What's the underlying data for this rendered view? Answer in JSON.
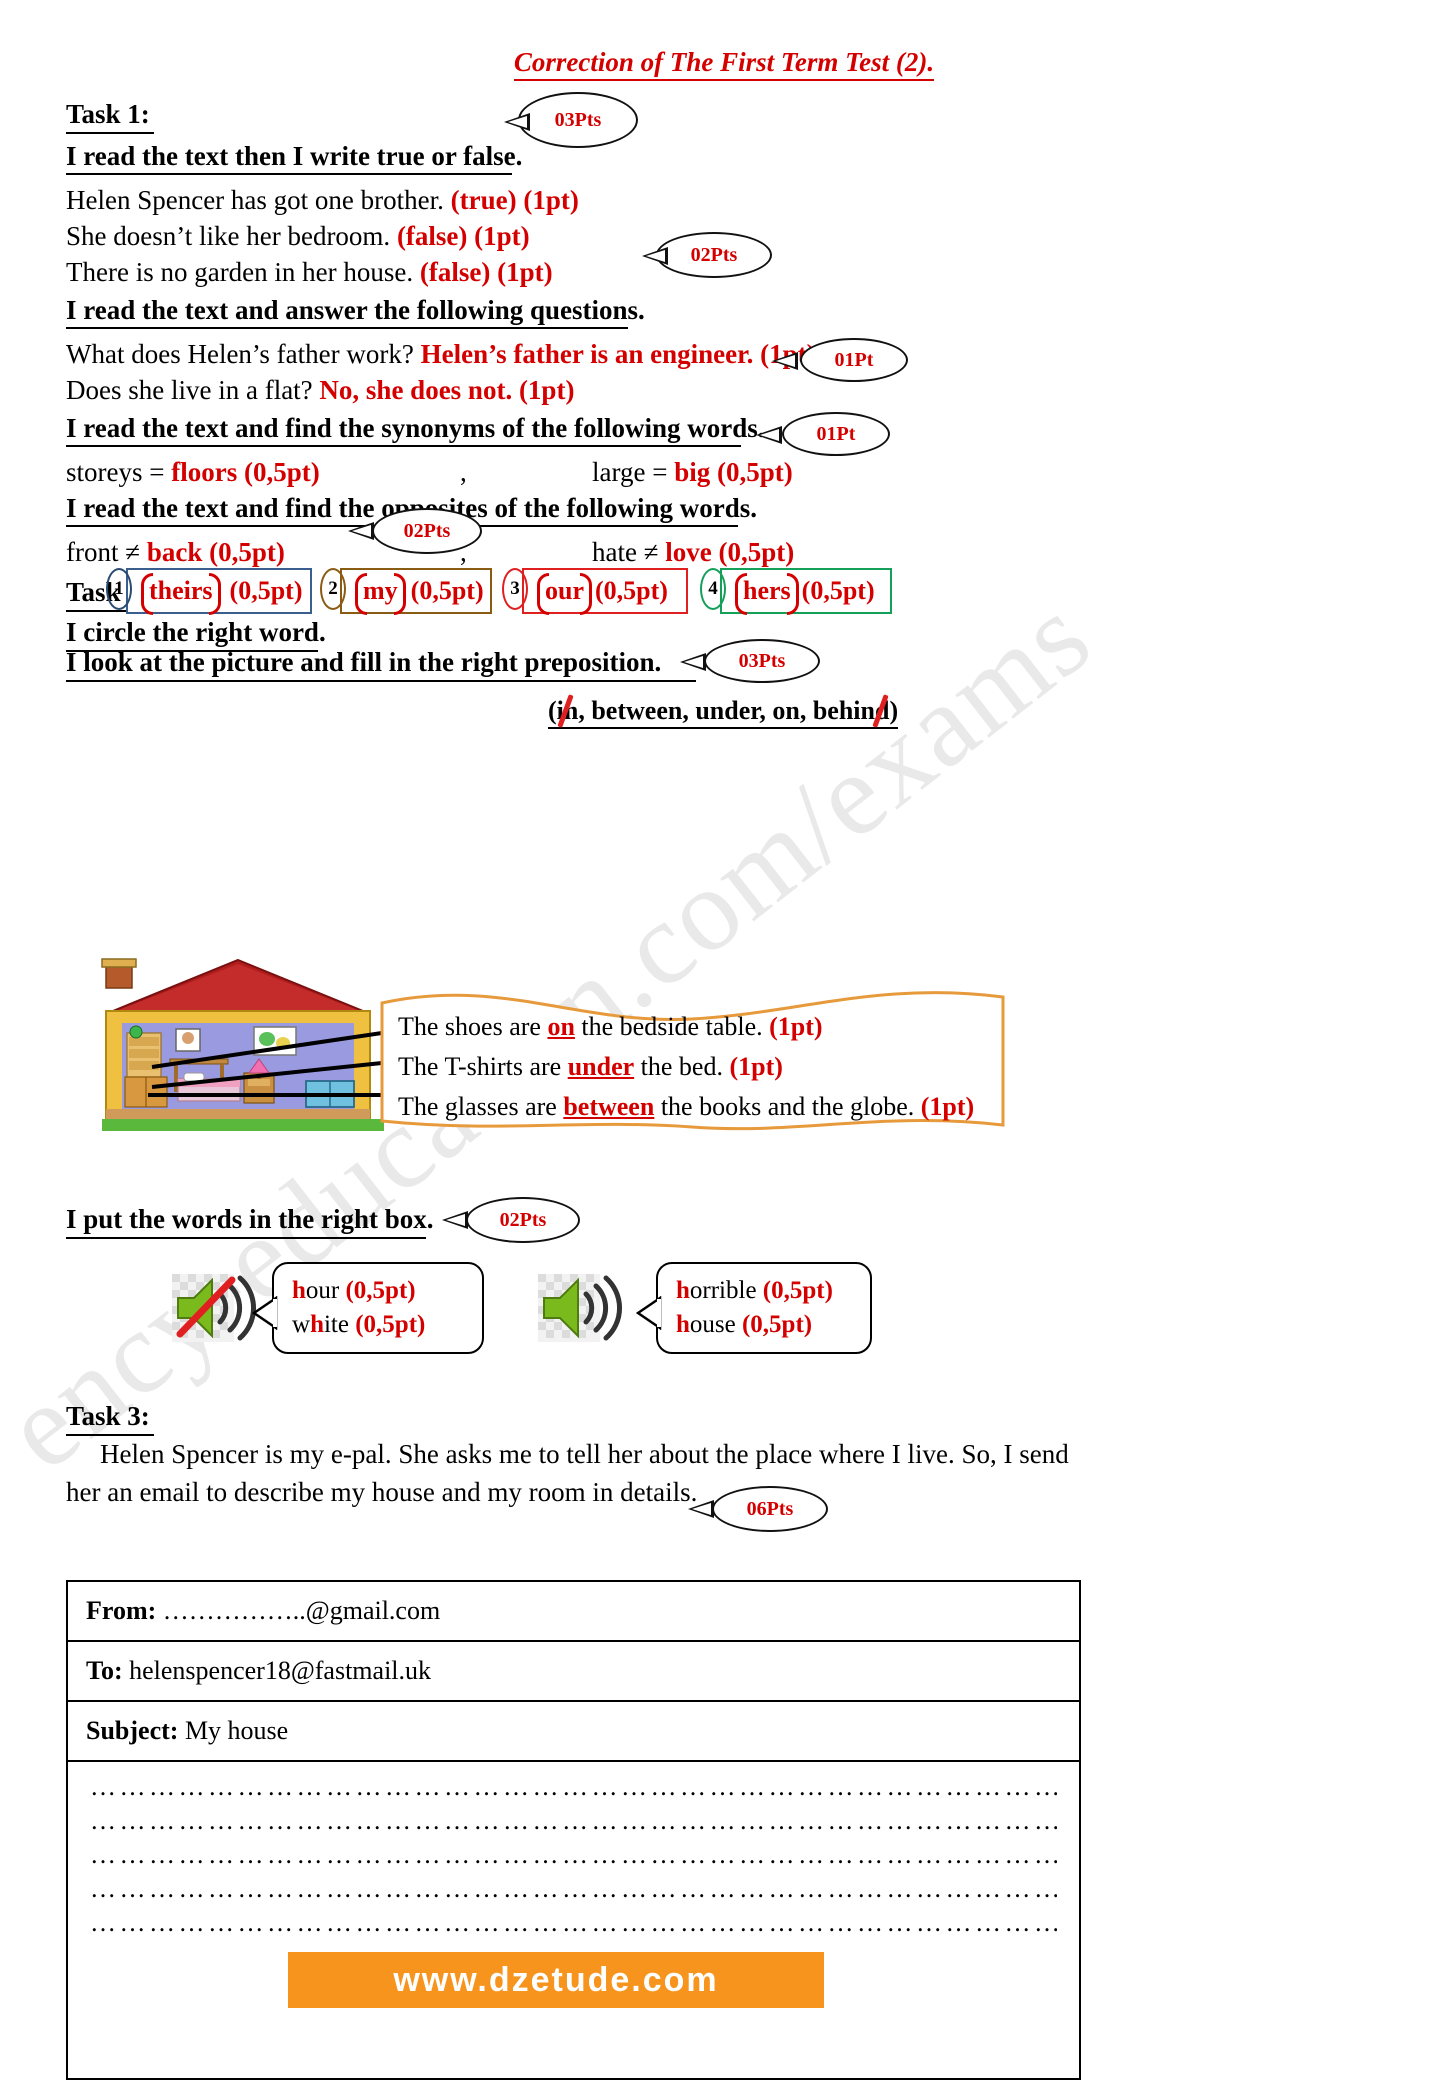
{
  "document": {
    "title": "Correction of The First Term Test (2).",
    "watermark": "ency-education.com/exams",
    "footer_url": "www.dzetude.com"
  },
  "task1": {
    "label": "Task 1:",
    "sections": [
      {
        "instruction": "I read the text then I write true or false.",
        "points": "03Pts",
        "items": [
          {
            "question": "Helen Spencer has got one brother.",
            "answer": "(true) (1pt)"
          },
          {
            "question": "She doesn’t like her bedroom.",
            "answer": "(false) (1pt)"
          },
          {
            "question": "There is no garden in her house.",
            "answer": "(false) (1pt)"
          }
        ]
      },
      {
        "instruction": "I read the text and answer the following questions.",
        "points": "02Pts",
        "items": [
          {
            "question": "What does Helen’s father work?",
            "answer": "Helen’s father is an engineer. (1pt)"
          },
          {
            "question": "Does she live in a flat?",
            "answer": "No, she does not. (1pt)"
          }
        ]
      },
      {
        "instruction": "I read the text and find the synonyms of the following words.",
        "points": "01Pt",
        "pairs": [
          {
            "left": "storeys =",
            "answer": "floors (0,5pt)"
          },
          {
            "separator": ","
          },
          {
            "left": "large =",
            "answer": "big (0,5pt)"
          }
        ]
      },
      {
        "instruction": "I read the text and find the opposites of the following words.",
        "points": "01Pt",
        "pairs": [
          {
            "left": "front ≠",
            "answer": "back (0,5pt)"
          },
          {
            "separator": ","
          },
          {
            "left": "hate ≠",
            "answer": "love (0,5pt)"
          }
        ]
      }
    ]
  },
  "task2": {
    "label": "Task 2:",
    "circle_activity": {
      "instruction": "I circle the right word.",
      "points": "02Pts",
      "options": [
        {
          "number": "1",
          "word": "theirs",
          "mark": "(0,5pt)",
          "box_color": "#3a5f8f"
        },
        {
          "number": "2",
          "word": "my",
          "mark": "(0,5pt)",
          "box_color": "#8a5b12"
        },
        {
          "number": "3",
          "word": "our",
          "mark": "(0,5pt)",
          "box_color": "#e02020"
        },
        {
          "number": "4",
          "word": "hers",
          "mark": "(0,5pt)",
          "box_color": "#15a05a"
        }
      ]
    },
    "preposition_activity": {
      "instruction": "I look at the picture and fill in the right preposition.",
      "points": "03Pts",
      "word_bank": "(in, between, under, on, behind)",
      "sentences": [
        {
          "before": "The shoes are ",
          "answer": "on",
          "after": " the bedside table.",
          "mark": "(1pt)"
        },
        {
          "before": "The T-shirts are ",
          "answer": "under",
          "after": " the bed.",
          "mark": "(1pt)"
        },
        {
          "before": "The glasses are ",
          "answer": "between",
          "after": " the books and the globe.",
          "mark": "(1pt)"
        }
      ]
    },
    "sorting_activity": {
      "instruction": "I put the words in the right box.",
      "points": "02Pts",
      "groups": [
        {
          "icon": "muted-speaker-icon",
          "words": [
            {
              "h": "h",
              "rest": "our",
              "mark": "(0,5pt)",
              "style": "h-red"
            },
            {
              "pre": "w",
              "h": "h",
              "rest": "ite",
              "mark": "(0,5pt)",
              "style": "h-red-mid"
            }
          ]
        },
        {
          "icon": "speaker-icon",
          "words": [
            {
              "h": "h",
              "rest": "orrible",
              "mark": "(0,5pt)",
              "style": "h-red"
            },
            {
              "h": "h",
              "rest": "ouse",
              "mark": "(0,5pt)",
              "style": "h-red"
            }
          ]
        }
      ]
    }
  },
  "task3": {
    "label": "Task 3:",
    "points": "06Pts",
    "prompt_line1": "Helen Spencer is my e-pal. She asks me to tell her about the place where I live. So, I send",
    "prompt_line2": "her an email to describe my house and my room in details.",
    "email": {
      "from_label": "From:",
      "from_value": "……………..@gmail.com",
      "to_label": "To:",
      "to_value": "helenspencer18@fastmail.uk",
      "subject_label": "Subject:",
      "subject_value": "My house",
      "body_lines": [
        "………………………………………………………………………………………………………………………",
        "………………………………………………………………………………………………………………………",
        "………………………………………………………………………………………………………………………",
        "………………………………………………………………………………………………………………………",
        "………………………………………………………………………………………………………………………"
      ]
    }
  }
}
